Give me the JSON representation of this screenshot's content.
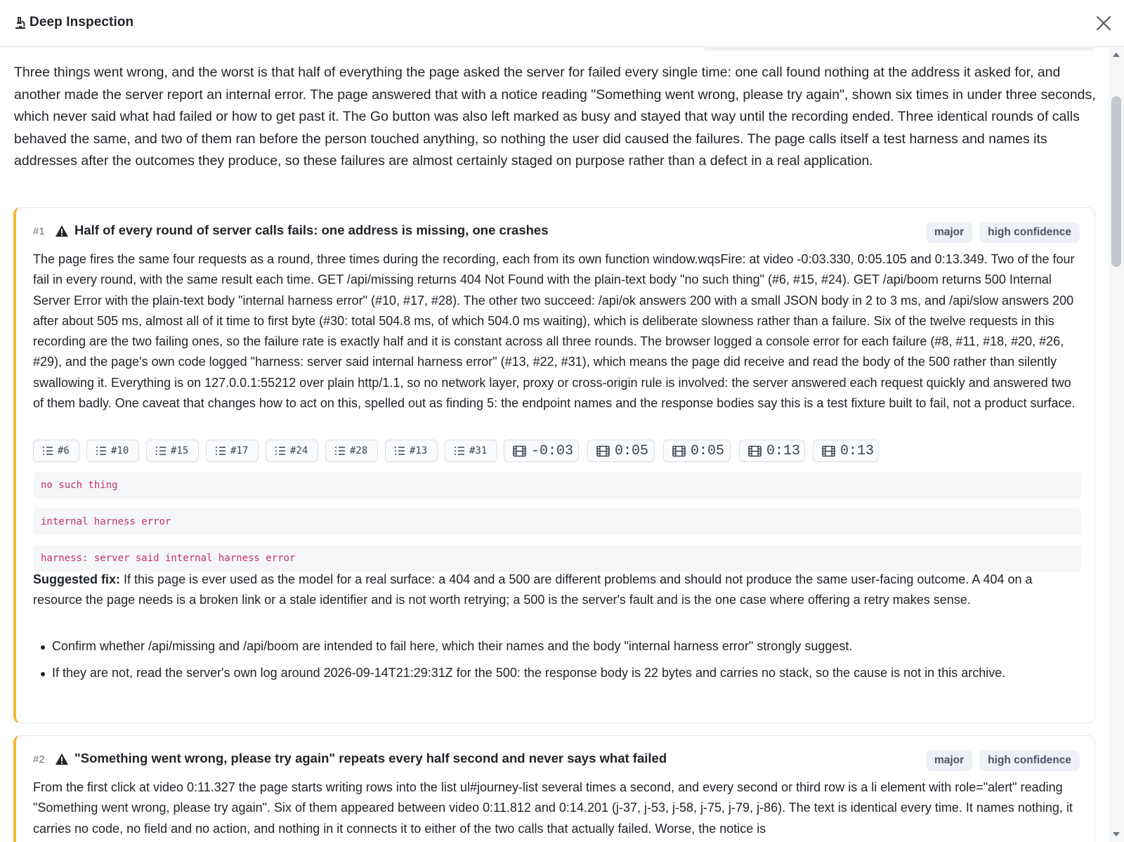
{
  "dialog": {
    "title": "Deep Inspection",
    "close_icon": "close-icon",
    "header_icon": "microscope-icon"
  },
  "summary": "Three things went wrong, and the worst is that half of everything the page asked the server for failed every single time: one call found nothing at the address it asked for, and another made the server report an internal error. The page answered that with a notice reading \"Something went wrong, please try again\", shown six times in under three seconds, which never said what had failed or how to get past it. The Go button was also left marked as busy and stayed that way until the recording ended. Three identical rounds of calls behaved the same, and two of them ran before the person touched anything, so nothing the user did caused the failures. The page calls itself a test harness and names its addresses after the outcomes they produce, so these failures are almost certainly staged on purpose rather than a defect in a real application.",
  "findings": [
    {
      "number": "#1",
      "title": "Half of every round of server calls fails: one address is missing, one crashes",
      "severity": "major",
      "confidence": "high confidence",
      "accent": "#f2b934",
      "body": "The page fires the same four requests as a round, three times during the recording, each from its own function window.wqsFire: at video -0:03.330, 0:05.105 and 0:13.349. Two of the four fail in every round, with the same result each time. GET /api/missing returns 404 Not Found with the plain-text body \"no such thing\" (#6, #15, #24). GET /api/boom returns 500 Internal Server Error with the plain-text body \"internal harness error\" (#10, #17, #28). The other two succeed: /api/ok answers 200 with a small JSON body in 2 to 3 ms, and /api/slow answers 200 after about 505 ms, almost all of it time to first byte (#30: total 504.8 ms, of which 504.0 ms waiting), which is deliberate slowness rather than a failure. Six of the twelve requests in this recording are the two failing ones, so the failure rate is exactly half and it is constant across all three rounds. The browser logged a console error for each failure (#8, #11, #18, #20, #26, #29), and the page's own code logged \"harness: server said internal harness error\" (#13, #22, #31), which means the page did receive and read the body of the 500 rather than silently swallowing it. Everything is on 127.0.0.1:55212 over plain http/1.1, so no network layer, proxy or cross-origin rule is involved: the server answered each request quickly and answered two of them badly. One caveat that changes how to act on this, spelled out as finding 5: the endpoint names and the response bodies say this is a test fixture built to fail, not a product surface.",
      "event_chips": [
        "#6",
        "#10",
        "#15",
        "#17",
        "#24",
        "#28",
        "#13",
        "#31"
      ],
      "video_chips": [
        "-0:03",
        "0:05",
        "0:05",
        "0:13",
        "0:13"
      ],
      "code_snippets": [
        "no such thing",
        "internal harness error",
        "harness: server said internal harness error"
      ],
      "fix_label": "Suggested fix:",
      "fix_text": "If this page is ever used as the model for a real surface: a 404 and a 500 are different problems and should not produce the same user-facing outcome. A 404 on a resource the page needs is a broken link or a stale identifier and is not worth retrying; a 500 is the server's fault and is the one case where offering a retry makes sense.",
      "fix_steps": [
        "Confirm whether /api/missing and /api/boom are intended to fail here, which their names and the body \"internal harness error\" strongly suggest.",
        "If they are not, read the server's own log around 2026-09-14T21:29:31Z for the 500: the response body is 22 bytes and carries no stack, so the cause is not in this archive."
      ]
    },
    {
      "number": "#2",
      "title": "\"Something went wrong, please try again\" repeats every half second and never says what failed",
      "severity": "major",
      "confidence": "high confidence",
      "accent": "#f2b934",
      "body": "From the first click at video 0:11.327 the page starts writing rows into the list ul#journey-list several times a second, and every second or third row is a li element with role=\"alert\" reading \"Something went wrong, please try again\". Six of them appeared between video 0:11.812 and 0:14.201 (j-37, j-53, j-58, j-75, j-79, j-86). The text is identical every time. It names nothing, it carries no code, no field and no action, and nothing in it connects it to either of the two calls that actually failed. Worse, the notice is"
    }
  ]
}
